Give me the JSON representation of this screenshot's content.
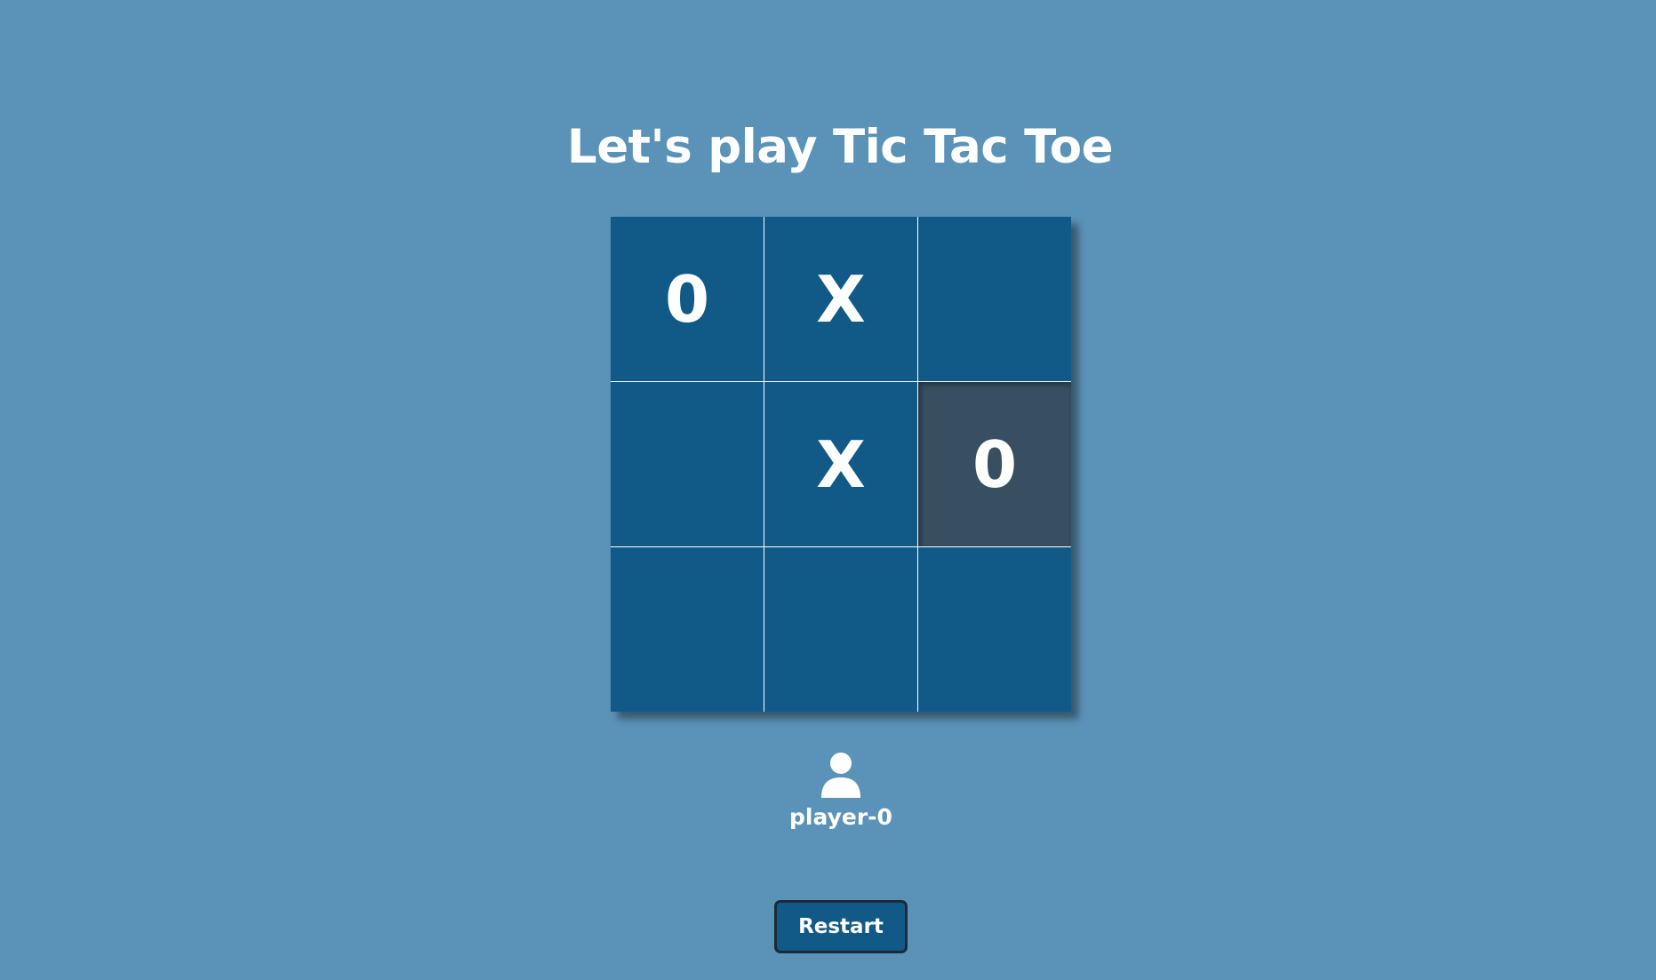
{
  "title": "Let's play Tic Tac Toe",
  "board": {
    "cells": [
      "0",
      "X",
      "",
      "",
      "X",
      "0",
      "",
      "",
      ""
    ],
    "highlighted_cell_index": 5
  },
  "player": {
    "icon": "user-icon",
    "name": "player-0"
  },
  "restart_label": "Restart",
  "colors": {
    "background": "#5b93b8",
    "cell": "#115a88",
    "cell_highlight": "#374f60",
    "text": "#ffffff"
  }
}
